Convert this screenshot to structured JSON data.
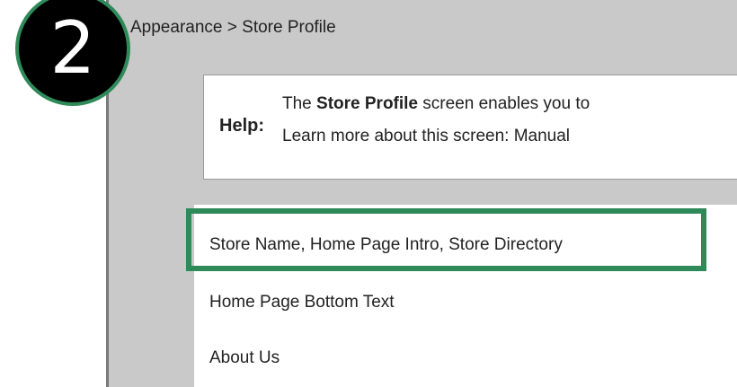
{
  "step_badge": {
    "number": "2"
  },
  "breadcrumb": {
    "parent": "Appearance",
    "separator": ">",
    "current": "Store Profile"
  },
  "help": {
    "label": "Help:",
    "line1_prefix": "The ",
    "line1_bold": "Store Profile",
    "line1_suffix": " screen enables you to",
    "line2": "Learn more about this screen: Manual"
  },
  "menu": {
    "items": [
      {
        "label": "Store Name, Home Page Intro, Store Directory",
        "highlighted": true
      },
      {
        "label": "Home Page Bottom Text",
        "highlighted": false
      },
      {
        "label": "About Us",
        "highlighted": false
      }
    ]
  },
  "colors": {
    "highlight_border": "#2f8a5a",
    "panel_background": "#c9c9c9",
    "badge_background": "#000000"
  }
}
